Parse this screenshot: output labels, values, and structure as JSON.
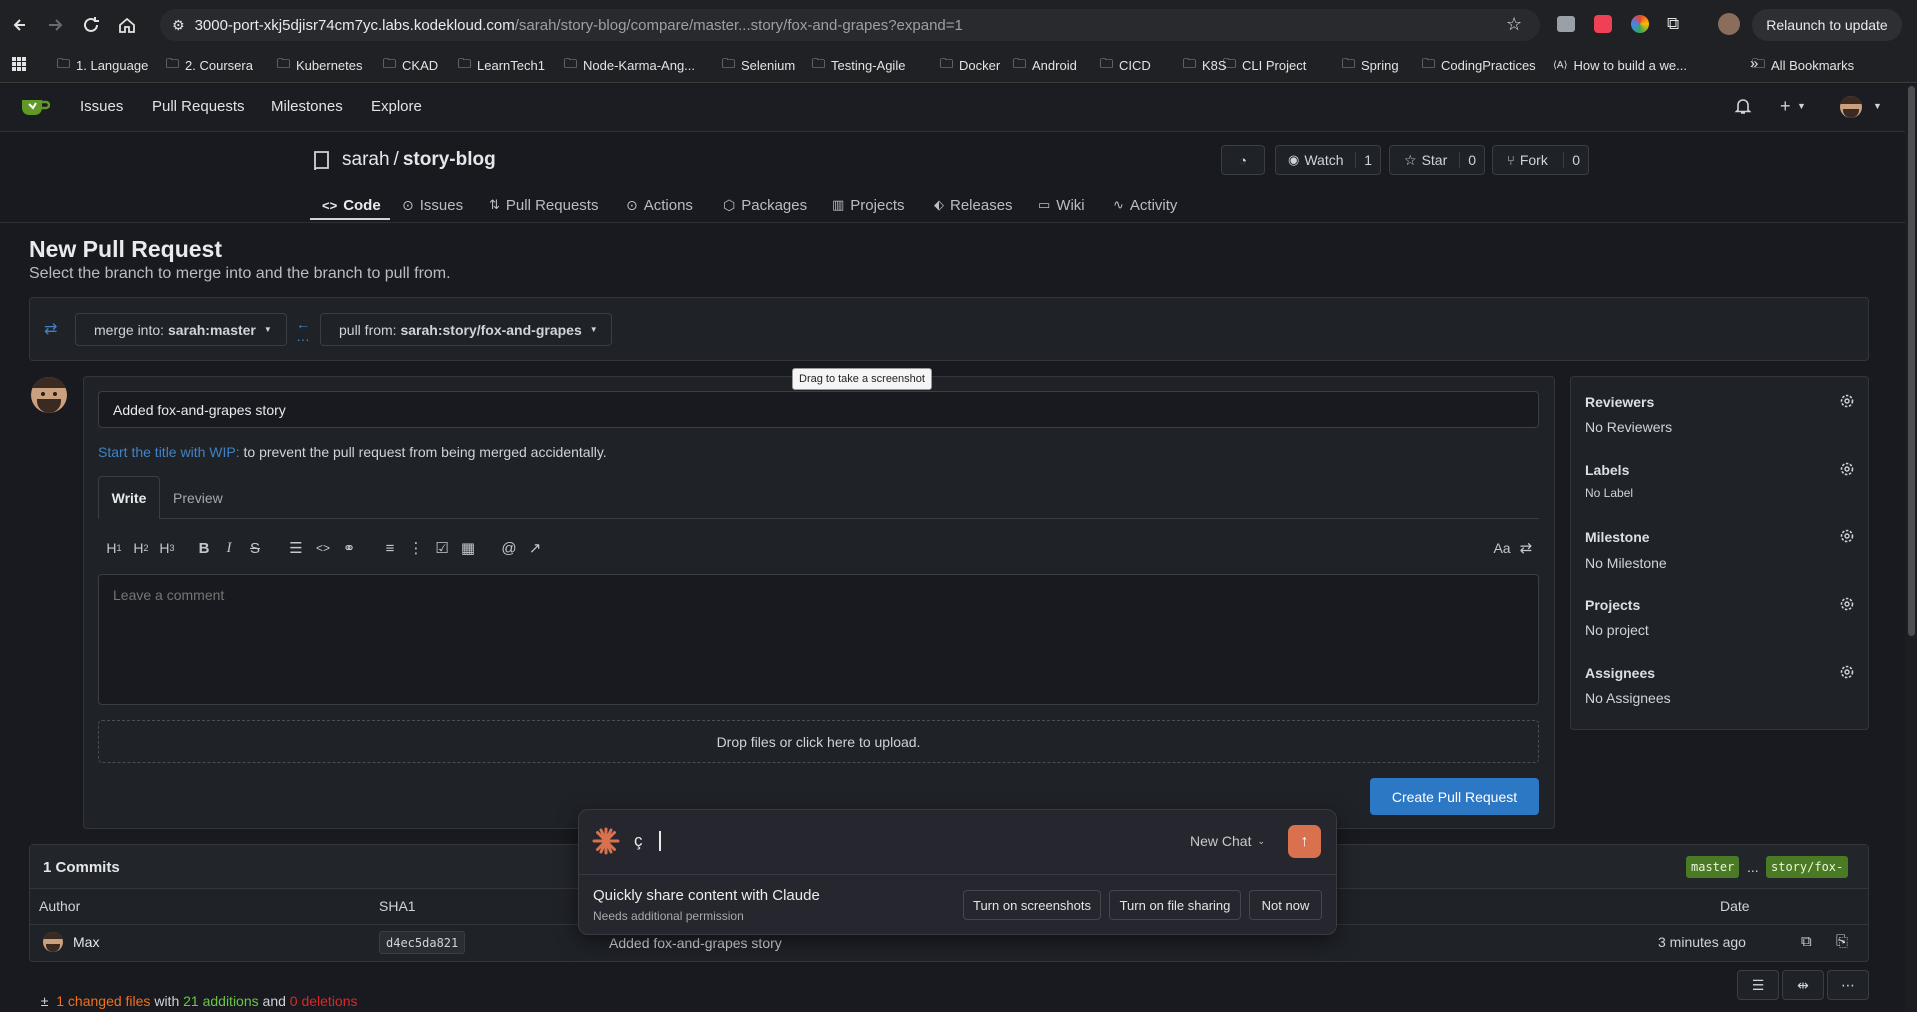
{
  "browser": {
    "url_host": "3000-port-xkj5djisr74cm7yc.labs.kodekloud.com",
    "url_path": "/sarah/story-blog/compare/master...story/fox-and-grapes?expand=1",
    "relaunch_label": "Relaunch to update",
    "bookmarks": [
      "1. Language",
      "2. Coursera",
      "Kubernetes",
      "CKAD",
      "LearnTech1",
      "Node-Karma-Ang...",
      "Selenium",
      "Testing-Agile",
      "Docker",
      "Android",
      "CICD",
      "K8S",
      "CLI Project",
      "Spring",
      "CodingPractices",
      "How to build a we..."
    ],
    "all_bookmarks": "All Bookmarks"
  },
  "nav": {
    "issues": "Issues",
    "pull_requests": "Pull Requests",
    "milestones": "Milestones",
    "explore": "Explore"
  },
  "repo": {
    "owner": "sarah",
    "separator": "/",
    "name": "story-blog",
    "watch_label": "Watch",
    "watch_count": "1",
    "star_label": "Star",
    "star_count": "0",
    "fork_label": "Fork",
    "fork_count": "0",
    "tabs": [
      "Code",
      "Issues",
      "Pull Requests",
      "Actions",
      "Packages",
      "Projects",
      "Releases",
      "Wiki",
      "Activity"
    ]
  },
  "page": {
    "title": "New Pull Request",
    "subtitle": "Select the branch to merge into and the branch to pull from.",
    "merge_into_prefix": "merge into: ",
    "merge_into_branch": "sarah:master",
    "pull_from_prefix": "pull from: ",
    "pull_from_branch": "sarah:story/fox-and-grapes",
    "tooltip": "Drag to take a screenshot"
  },
  "form": {
    "title_value": "Added fox-and-grapes story",
    "wip_link": "Start the title with WIP:",
    "wip_rest": " to prevent the pull request from being merged accidentally.",
    "tab_write": "Write",
    "tab_preview": "Preview",
    "comment_placeholder": "Leave a comment",
    "dropzone": "Drop files or click here to upload.",
    "create_button": "Create Pull Request",
    "font_toggle": "Aa"
  },
  "sidebar": {
    "reviewers_title": "Reviewers",
    "reviewers_value": "No Reviewers",
    "labels_title": "Labels",
    "labels_value": "No Label",
    "milestone_title": "Milestone",
    "milestone_value": "No Milestone",
    "projects_title": "Projects",
    "projects_value": "No project",
    "assignees_title": "Assignees",
    "assignees_value": "No Assignees"
  },
  "commits": {
    "heading": "1 Commits",
    "base_tag": "master",
    "ellipsis": "...",
    "head_tag": "story/fox-",
    "col_author": "Author",
    "col_sha": "SHA1",
    "col_date": "Date",
    "row_author": "Max",
    "row_sha": "d4ec5da821",
    "row_message": "Added fox-and-grapes story",
    "row_date": "3 minutes ago"
  },
  "diffstat": {
    "plusminus": "±",
    "changed": "1 changed files",
    "with": " with ",
    "additions": "21 additions",
    "and": " and ",
    "deletions": "0 deletions"
  },
  "claude": {
    "input_value": "ç",
    "new_chat": "New Chat",
    "share_title": "Quickly share content with Claude",
    "share_sub": "Needs additional permission",
    "btn_screens": "Turn on screenshots",
    "btn_files": "Turn on file sharing",
    "btn_notnow": "Not now"
  },
  "colors": {
    "accent_blue": "#4183c4",
    "primary_button": "#2c78c4",
    "additions_green": "#6cc644",
    "deletions_red": "#db2828",
    "changed_orange": "#f2711c",
    "claude_orange": "#d9704e"
  }
}
